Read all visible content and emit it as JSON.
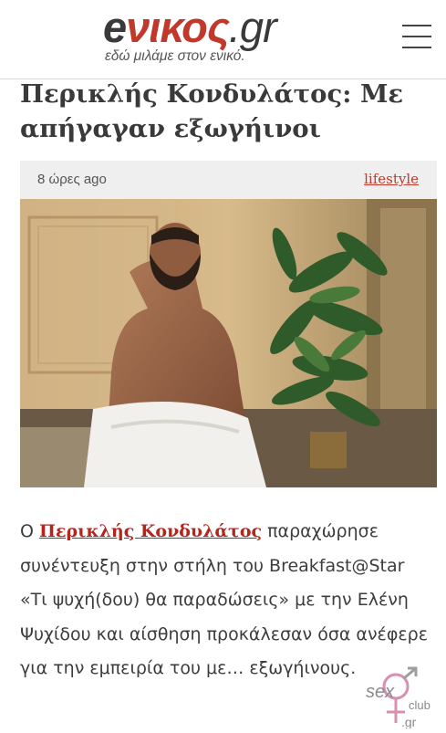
{
  "site": {
    "logo": {
      "e": "e",
      "nikos": "νικος",
      "gr": ".gr"
    },
    "tagline": "εδώ μιλάμε στον ενικό."
  },
  "article": {
    "title": "Περικλής Κονδυλάτος: Με απήγαγαν εξωγήινοι",
    "time": "8 ώρες ago",
    "category": "lifestyle",
    "body_intro": "Ο ",
    "body_link": "Περικλής Κονδυλάτος",
    "body_rest": " παραχώρησε συνέντευξη στην στήλη του Breakfast@Star «Τι ψυχή(δου) θα παραδώσεις» με την Ελένη Ψυχίδου και αίσθηση προκάλεσαν όσα ανέφερε για την εμπειρία του με… εξωγήινους."
  },
  "badge": {
    "sex": "sex",
    "club": "club",
    "gr": ".gr"
  },
  "colors": {
    "accent": "#c0392b",
    "text": "#3a3a3a",
    "meta_bg": "#efefef"
  },
  "icons": {
    "menu": "hamburger-menu-icon"
  }
}
